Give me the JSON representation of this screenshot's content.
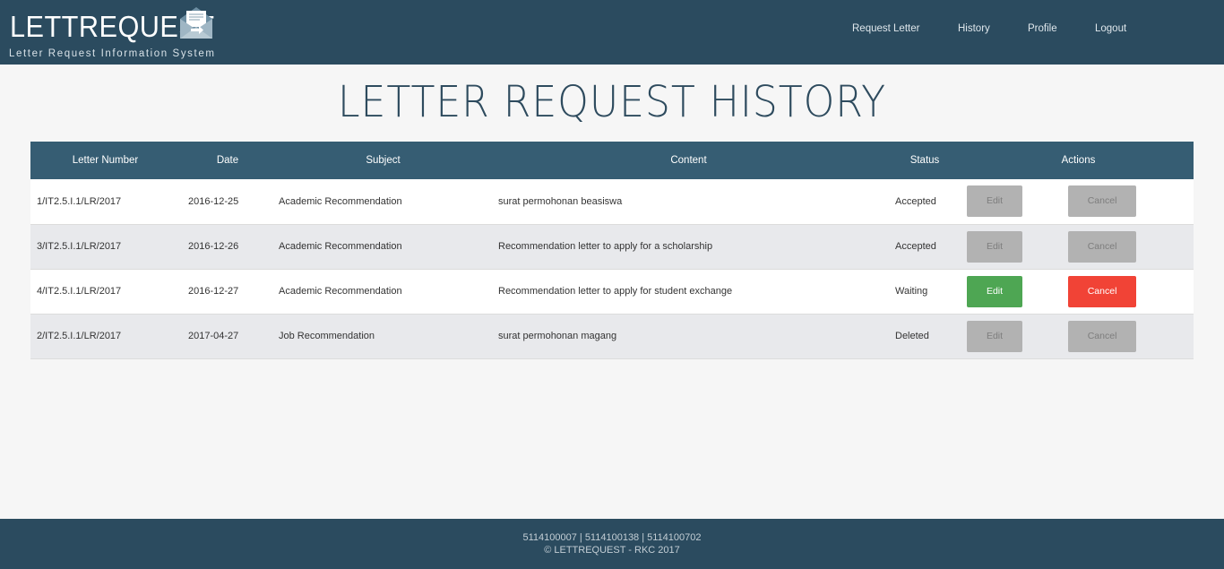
{
  "brand": {
    "name": "LETTREQUEST",
    "tagline": "Letter Request Information System",
    "logo_icon": "envelope-icon"
  },
  "nav": {
    "request_letter": "Request Letter",
    "history": "History",
    "profile": "Profile",
    "logout": "Logout"
  },
  "page": {
    "title": "LETTER REQUEST HISTORY"
  },
  "table": {
    "headers": [
      "Letter Number",
      "Date",
      "Subject",
      "Content",
      "Status",
      "Actions"
    ],
    "rows": [
      {
        "letter_number": "1/IT2.5.I.1/LR/2017",
        "date": "2016-12-25",
        "subject": "Academic Recommendation",
        "content": "surat permohonan beasiswa",
        "status": "Accepted",
        "edit_label": "Edit",
        "cancel_label": "Cancel"
      },
      {
        "letter_number": "3/IT2.5.I.1/LR/2017",
        "date": "2016-12-26",
        "subject": "Academic Recommendation",
        "content": "Recommendation letter to apply for a scholarship",
        "status": "Accepted",
        "edit_label": "Edit",
        "cancel_label": "Cancel"
      },
      {
        "letter_number": "4/IT2.5.I.1/LR/2017",
        "date": "2016-12-27",
        "subject": "Academic Recommendation",
        "content": "Recommendation letter to apply for student exchange",
        "status": "Waiting",
        "edit_label": "Edit",
        "cancel_label": "Cancel"
      },
      {
        "letter_number": "2/IT2.5.I.1/LR/2017",
        "date": "2017-04-27",
        "subject": "Job Recommendation",
        "content": "surat permohonan magang",
        "status": "Deleted",
        "edit_label": "Edit",
        "cancel_label": "Cancel"
      }
    ]
  },
  "footer": {
    "ids": "5114100007 | 5114100138 | 5114100702",
    "copyright": "© LETTREQUEST - RKC 2017"
  },
  "colors": {
    "header_bar": "#2b4b5f",
    "table_header": "#365d73",
    "edit_active": "#4ea653",
    "cancel_active": "#f14336",
    "disabled": "#b2b2b2"
  }
}
